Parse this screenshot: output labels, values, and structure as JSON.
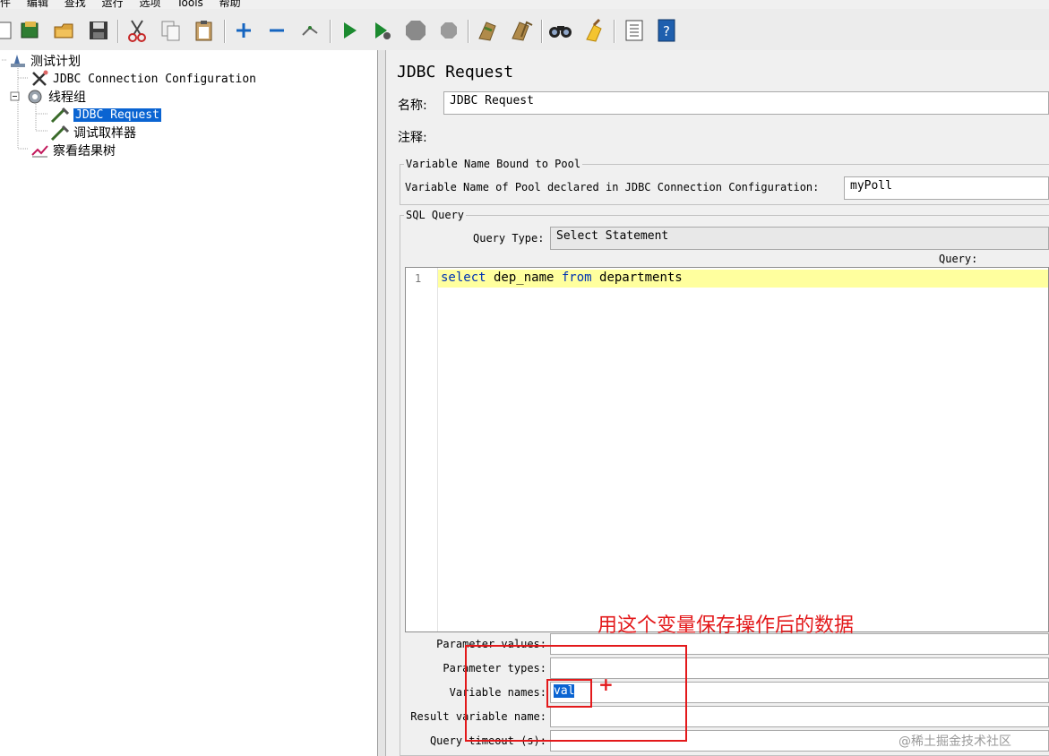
{
  "menu": [
    "件",
    "编辑",
    "查找",
    "运行",
    "选项",
    "Tools",
    "帮助"
  ],
  "toolbar_icons": [
    "new-icon",
    "templates-icon",
    "open-icon",
    "save-icon",
    "cut-icon",
    "copy-icon",
    "paste-icon",
    "expand-icon",
    "collapse-icon",
    "toggle-icon",
    "start-icon",
    "start-no-pause-icon",
    "stop-icon",
    "shutdown-icon",
    "clear-icon",
    "clear-all-icon",
    "search-icon",
    "reset-search-icon",
    "function-helper-icon",
    "help-icon"
  ],
  "tree": {
    "items": [
      {
        "label": "测试计划"
      },
      {
        "label": "JDBC Connection Configuration"
      },
      {
        "label": "线程组"
      },
      {
        "label": "JDBC Request"
      },
      {
        "label": "调试取样器"
      },
      {
        "label": "察看结果树"
      }
    ]
  },
  "panel": {
    "title": "JDBC Request",
    "name_label": "名称:",
    "name_value": "JDBC Request",
    "comment_label": "注释:",
    "comment_value": "",
    "pool_group_title": "Variable Name Bound to Pool",
    "pool_label": "Variable Name of Pool declared in JDBC Connection Configuration:",
    "pool_value": "myPoll",
    "sql_group_title": "SQL Query",
    "query_type_label": "Query Type:",
    "query_type_value": "Select Statement",
    "query_label": "Query:",
    "line_number": "1",
    "code": {
      "kw1": "select",
      "mid": " dep_name ",
      "kw2": "from",
      "end": " departments"
    },
    "params": {
      "parameter_values_label": "Parameter values:",
      "parameter_types_label": "Parameter types:",
      "variable_names_label": "Variable names:",
      "variable_names_value": "val",
      "result_variable_label": "Result variable name:",
      "query_timeout_label": "Query timeout (s):"
    }
  },
  "annotation": {
    "text": "用这个变量保存操作后的数据",
    "plus": "+",
    "color": "#e3191b"
  },
  "watermark": "@稀土掘金技术社区",
  "colors": {
    "selection": "#0a64d2",
    "line_highlight": "#ffff9e",
    "keyword": "#0033b3"
  }
}
